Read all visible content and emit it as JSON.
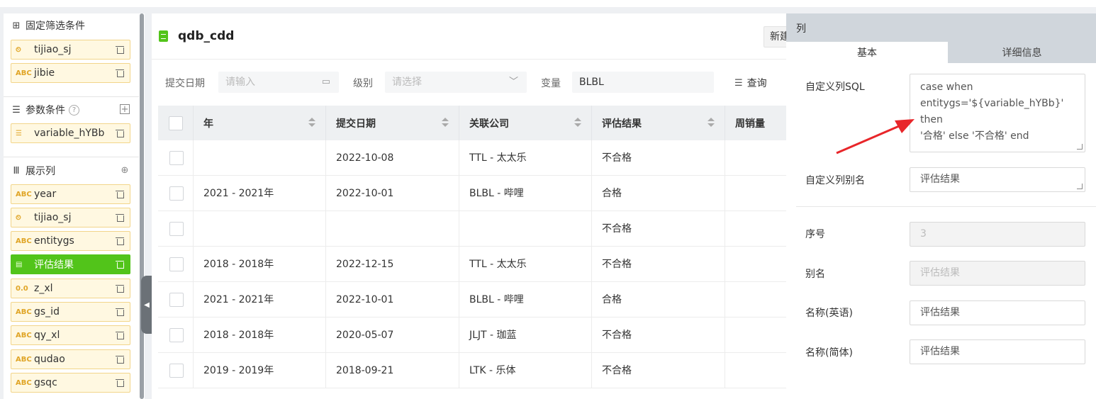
{
  "left": {
    "fixed_filter": {
      "title": "固定筛选条件",
      "fields": [
        {
          "type_label": "⏲",
          "name": "tijiao_sj"
        },
        {
          "type_label": "ABC",
          "name": "jibie"
        }
      ]
    },
    "params": {
      "title": "参数条件",
      "help": "?",
      "add": "+",
      "fields": [
        {
          "type_label": "☰",
          "name": "variable_hYBb"
        }
      ]
    },
    "columns": {
      "title": "展示列",
      "fields": [
        {
          "type_label": "ABC",
          "name": "year"
        },
        {
          "type_label": "⏲",
          "name": "tijiao_sj"
        },
        {
          "type_label": "ABC",
          "name": "entitygs"
        },
        {
          "type_label": "▤",
          "name": "评估结果",
          "active": true
        },
        {
          "type_label": "0.0",
          "name": "z_xl"
        },
        {
          "type_label": "ABC",
          "name": "gs_id"
        },
        {
          "type_label": "ABC",
          "name": "qy_xl"
        },
        {
          "type_label": "ABC",
          "name": "qudao"
        },
        {
          "type_label": "ABC",
          "name": "gsqc"
        }
      ]
    }
  },
  "main": {
    "title": "qdb_cdd",
    "new_button": "新建",
    "filters": {
      "date_label": "提交日期",
      "date_placeholder": "请输入",
      "level_label": "级别",
      "level_placeholder": "请选择",
      "var_label": "变量",
      "var_value": "BLBL",
      "query": "查询"
    },
    "table": {
      "headers": [
        "年",
        "提交日期",
        "关联公司",
        "评估结果",
        "周销量"
      ],
      "rows": [
        [
          "",
          "2022-10-08",
          "TTL - 太太乐",
          "不合格",
          ""
        ],
        [
          "2021 - 2021年",
          "2022-10-01",
          "BLBL - 哔哩",
          "合格",
          ""
        ],
        [
          "",
          "",
          "",
          "不合格",
          ""
        ],
        [
          "2018 - 2018年",
          "2022-12-15",
          "TTL - 太太乐",
          "不合格",
          ""
        ],
        [
          "2021 - 2021年",
          "2022-10-01",
          "BLBL - 哔哩",
          "合格",
          ""
        ],
        [
          "2018 - 2018年",
          "2020-05-07",
          "JLJT - 珈蓝",
          "不合格",
          ""
        ],
        [
          "2019 - 2019年",
          "2018-09-21",
          "LTK - 乐体",
          "不合格",
          ""
        ]
      ]
    }
  },
  "panel": {
    "title": "列",
    "tab_basic": "基本",
    "tab_detail": "详细信息",
    "sql_label": "自定义列SQL",
    "sql_line1": "case when",
    "sql_line2": "entitygs='${variable_hYBb}' then",
    "sql_line3": "'合格' else '不合格' end",
    "alias_custom_label": "自定义列别名",
    "alias_custom_value": "评估结果",
    "seq_label": "序号",
    "seq_value": "3",
    "alias_label": "别名",
    "alias_value": "评估结果",
    "name_en_label": "名称(英语)",
    "name_en_value": "评估结果",
    "name_zh_label": "名称(简体)",
    "name_zh_value": "评估结果"
  },
  "colors": {
    "accent_green": "#52c41a",
    "field_bg": "#fff8e1",
    "arrow_red": "#e8262a"
  }
}
